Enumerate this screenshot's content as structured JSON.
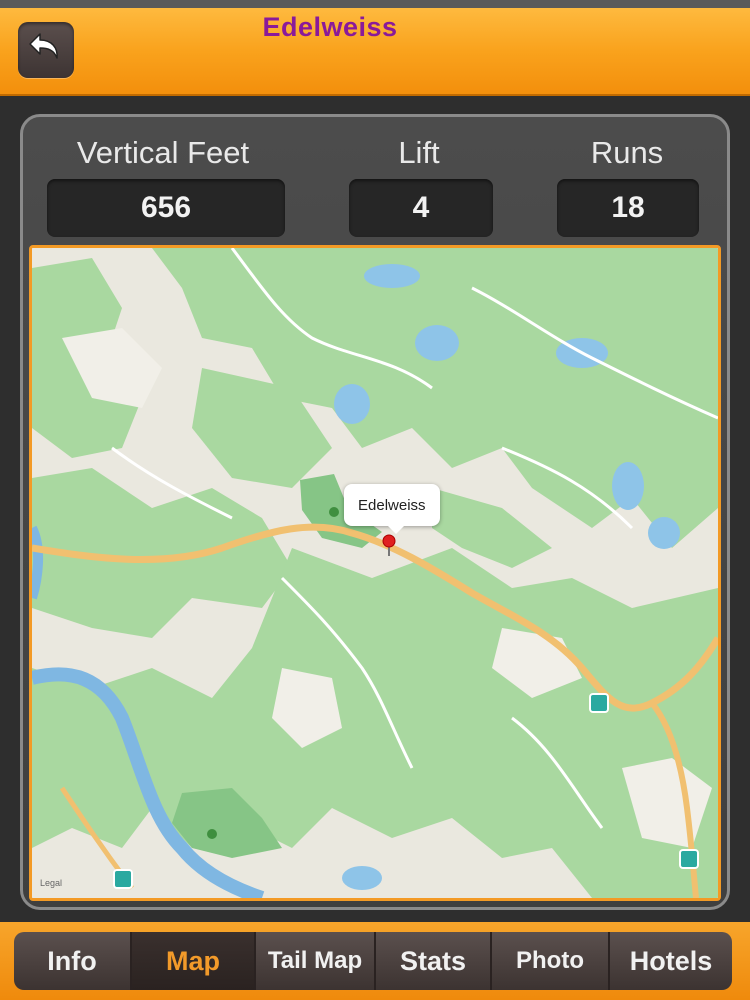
{
  "header": {
    "title": "Edelweiss",
    "back_icon": "back-arrow-icon",
    "accent_color": "#f9a21c",
    "title_color": "#8a1a9a"
  },
  "stats": {
    "vertical_label": "Vertical Feet",
    "vertical_value": "656",
    "lift_label": "Lift",
    "lift_value": "4",
    "runs_label": "Runs",
    "runs_value": "18"
  },
  "map": {
    "marker_label": "Edelweiss",
    "legal": "Legal",
    "marker_color": "#e02020"
  },
  "tabs": [
    {
      "label": "Info",
      "active": false
    },
    {
      "label": "Map",
      "active": true
    },
    {
      "label": "Tail Map",
      "active": false
    },
    {
      "label": "Stats",
      "active": false
    },
    {
      "label": "Photo",
      "active": false
    },
    {
      "label": "Hotels",
      "active": false
    }
  ]
}
